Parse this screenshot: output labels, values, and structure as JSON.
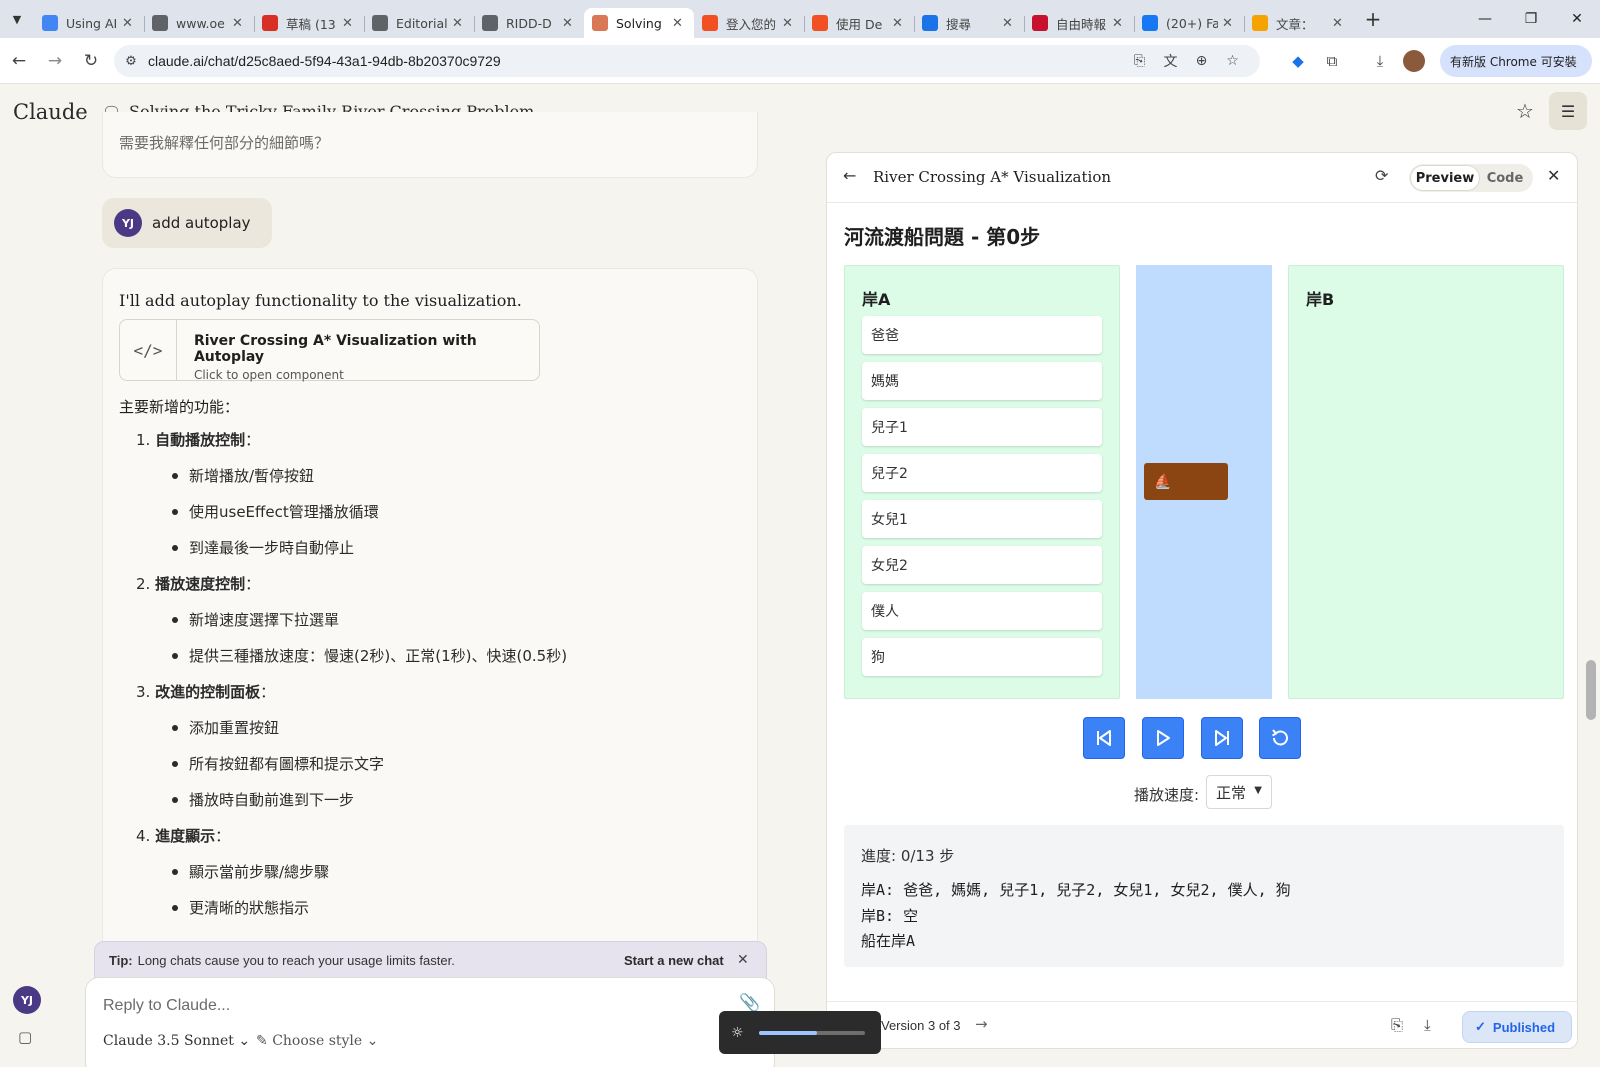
{
  "browser": {
    "tabs": [
      {
        "title": "Using AI",
        "fav_color": "#4285f4",
        "active": false
      },
      {
        "title": "www.oe",
        "fav_color": "#5f6368",
        "active": false
      },
      {
        "title": "草稿 (13",
        "fav_color": "#d93025",
        "active": false
      },
      {
        "title": "Editorial",
        "fav_color": "#5f6368",
        "active": false
      },
      {
        "title": "RIDD-D",
        "fav_color": "#5f6368",
        "active": false
      },
      {
        "title": "Solving",
        "fav_color": "#d97757",
        "active": true
      },
      {
        "title": "登入您的",
        "fav_color": "#f25022",
        "active": false
      },
      {
        "title": "使用 De",
        "fav_color": "#f25022",
        "active": false
      },
      {
        "title": "搜尋",
        "fav_color": "#1a73e8",
        "active": false
      },
      {
        "title": "自由時報",
        "fav_color": "#c8102e",
        "active": false
      },
      {
        "title": "(20+) Fa",
        "fav_color": "#1877f2",
        "active": false
      },
      {
        "title": "文章：",
        "fav_color": "#f4a300",
        "active": false
      }
    ],
    "url": "claude.ai/chat/d25c8aed-5f94-43a1-94db-8b20370c9729",
    "update_label": "有新版 Chrome 可安裝"
  },
  "app": {
    "brand": "Claude",
    "chat_title": "Solving the Tricky Family River Crossing Problem"
  },
  "chat": {
    "prev_text": "需要我解釋任何部分的細節嗎？",
    "user_initials": "YJ",
    "user_message": "add autoplay",
    "reply_intro": "I'll add autoplay functionality to the visualization.",
    "artifact": {
      "title": "River Crossing A* Visualization with Autoplay",
      "subtitle": "Click to open component"
    },
    "features_heading": "主要新增的功能：",
    "features": [
      {
        "title": "自動播放控制",
        "items": [
          "新增播放/暫停按鈕",
          "使用useEffect管理播放循環",
          "到達最後一步時自動停止"
        ]
      },
      {
        "title": "播放速度控制",
        "items": [
          "新增速度選擇下拉選單",
          "提供三種播放速度：慢速(2秒)、正常(1秒)、快速(0.5秒)"
        ]
      },
      {
        "title": "改進的控制面板",
        "items": [
          "添加重置按鈕",
          "所有按鈕都有圖標和提示文字",
          "播放時自動前進到下一步"
        ]
      },
      {
        "title": "進度顯示",
        "items": [
          "顯示當前步驟/總步驟",
          "更清晰的狀態指示"
        ]
      }
    ],
    "tip_label": "Tip:",
    "tip_text": "Long chats cause you to reach your usage limits faster.",
    "tip_link": "Start a new chat",
    "input_placeholder": "Reply to Claude...",
    "model": "Claude 3.5 Sonnet",
    "style": "Choose style"
  },
  "panel": {
    "title": "River Crossing A* Visualization",
    "preview_label": "Preview",
    "code_label": "Code",
    "viz_title": "河流渡船問題 - 第0步",
    "bank_a_label": "岸A",
    "bank_b_label": "岸B",
    "bank_a_people": [
      "爸爸",
      "媽媽",
      "兒子1",
      "兒子2",
      "女兒1",
      "女兒2",
      "僕人",
      "狗"
    ],
    "boat_icon": "⛵",
    "speed_label": "播放速度:",
    "speed_value": "正常",
    "progress_text": "進度: 0/13 步",
    "status_bank_a": "岸A: 爸爸, 媽媽, 兒子1, 兒子2, 女兒1, 女兒2, 僕人, 狗",
    "status_bank_b": "岸B: 空",
    "status_boat": "船在岸A",
    "version": "Version 3 of 3",
    "published_label": "Published"
  },
  "brightness": {
    "level": 0.55
  },
  "colors": {
    "bank": "#dcfce7",
    "river": "#bfdbfe",
    "boat": "#8b4513",
    "button": "#3b82f6",
    "accent": "#2563eb"
  }
}
